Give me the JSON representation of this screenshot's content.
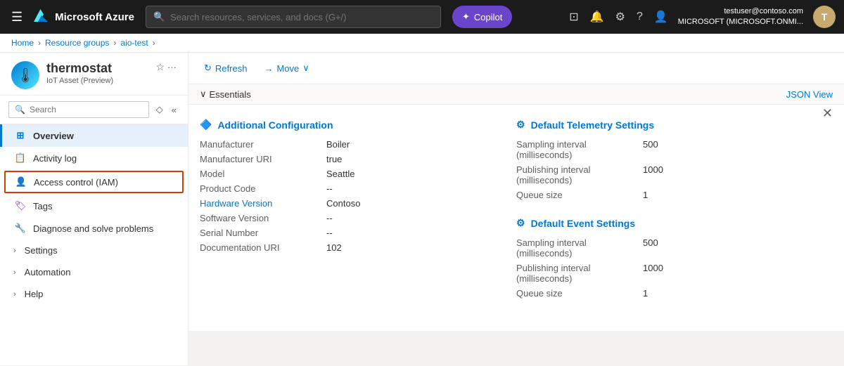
{
  "topnav": {
    "azure_title": "Microsoft Azure",
    "search_placeholder": "Search resources, services, and docs (G+/)",
    "copilot_label": "Copilot",
    "user_name": "testuser@contoso.com",
    "user_tenant": "MICROSOFT (MICROSOFT.ONMI...",
    "avatar_letter": "T"
  },
  "breadcrumb": {
    "items": [
      "Home",
      "Resource groups",
      "aio-test"
    ]
  },
  "sidebar": {
    "resource_name": "thermostat",
    "resource_subtitle": "IoT Asset (Preview)",
    "search_placeholder": "Search",
    "nav_items": [
      {
        "id": "overview",
        "label": "Overview",
        "icon": "🏠",
        "active": true
      },
      {
        "id": "activity-log",
        "label": "Activity log",
        "icon": "📋",
        "active": false
      },
      {
        "id": "access-control",
        "label": "Access control (IAM)",
        "icon": "👤",
        "active": false,
        "highlighted": true
      },
      {
        "id": "tags",
        "label": "Tags",
        "icon": "🏷",
        "active": false
      },
      {
        "id": "diagnose",
        "label": "Diagnose and solve problems",
        "icon": "🔧",
        "active": false
      },
      {
        "id": "settings",
        "label": "Settings",
        "icon": "",
        "active": false,
        "expandable": true
      },
      {
        "id": "automation",
        "label": "Automation",
        "icon": "",
        "active": false,
        "expandable": true
      },
      {
        "id": "help",
        "label": "Help",
        "icon": "",
        "active": false,
        "expandable": true
      }
    ]
  },
  "toolbar": {
    "refresh_label": "Refresh",
    "move_label": "Move"
  },
  "essentials": {
    "toggle_label": "Essentials",
    "json_view_label": "JSON View"
  },
  "additional_config": {
    "title": "Additional Configuration",
    "fields": [
      {
        "label": "Manufacturer",
        "value": "Boiler"
      },
      {
        "label": "Manufacturer URI",
        "value": "true"
      },
      {
        "label": "Model",
        "value": "Seattle"
      },
      {
        "label": "Product Code",
        "value": "--"
      },
      {
        "label": "Hardware Version",
        "value": "Contoso",
        "link": true
      },
      {
        "label": "Software Version",
        "value": "--"
      },
      {
        "label": "Serial Number",
        "value": "--"
      },
      {
        "label": "Documentation URI",
        "value": "102"
      }
    ]
  },
  "default_telemetry": {
    "title": "Default Telemetry Settings",
    "fields": [
      {
        "label": "Sampling interval (milliseconds)",
        "value": "500"
      },
      {
        "label": "Publishing interval (milliseconds)",
        "value": "1000"
      },
      {
        "label": "Queue size",
        "value": "1"
      }
    ]
  },
  "default_event": {
    "title": "Default Event Settings",
    "fields": [
      {
        "label": "Sampling interval (milliseconds)",
        "value": "500"
      },
      {
        "label": "Publishing interval (milliseconds)",
        "value": "1000"
      },
      {
        "label": "Queue size",
        "value": "1"
      }
    ]
  }
}
